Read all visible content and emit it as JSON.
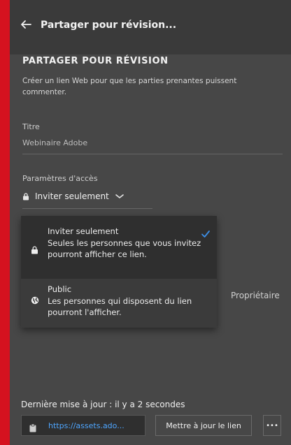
{
  "header": {
    "title": "Partager pour révision..."
  },
  "section": {
    "title": "PARTAGER POUR RÉVISION",
    "description": "Créer un lien Web pour que les parties prenantes puissent commenter."
  },
  "fields": {
    "title_label": "Titre",
    "title_value": "Webinaire Adobe",
    "access_label": "Paramètres d'accès",
    "access_value": "Inviter seulement"
  },
  "dropdown": {
    "options": [
      {
        "title": "Inviter seulement",
        "description": "Seules les personnes que vous invitez pourront afficher ce lien.",
        "selected": true,
        "icon": "lock-icon"
      },
      {
        "title": "Public",
        "description": "Les personnes qui disposent du lien pourront l'afficher.",
        "selected": false,
        "icon": "globe-icon"
      }
    ]
  },
  "owner_label": "Propriétaire",
  "footer": {
    "updated_text": "Dernière mise à jour :  il y a 2 secondes",
    "url": "https://assets.ado...",
    "update_button": "Mettre à jour le lien",
    "more_button": "•••"
  },
  "colors": {
    "background_frame": "#d5121f",
    "panel": "#474747",
    "link": "#4ea6ff",
    "check": "#3d8fe6"
  }
}
